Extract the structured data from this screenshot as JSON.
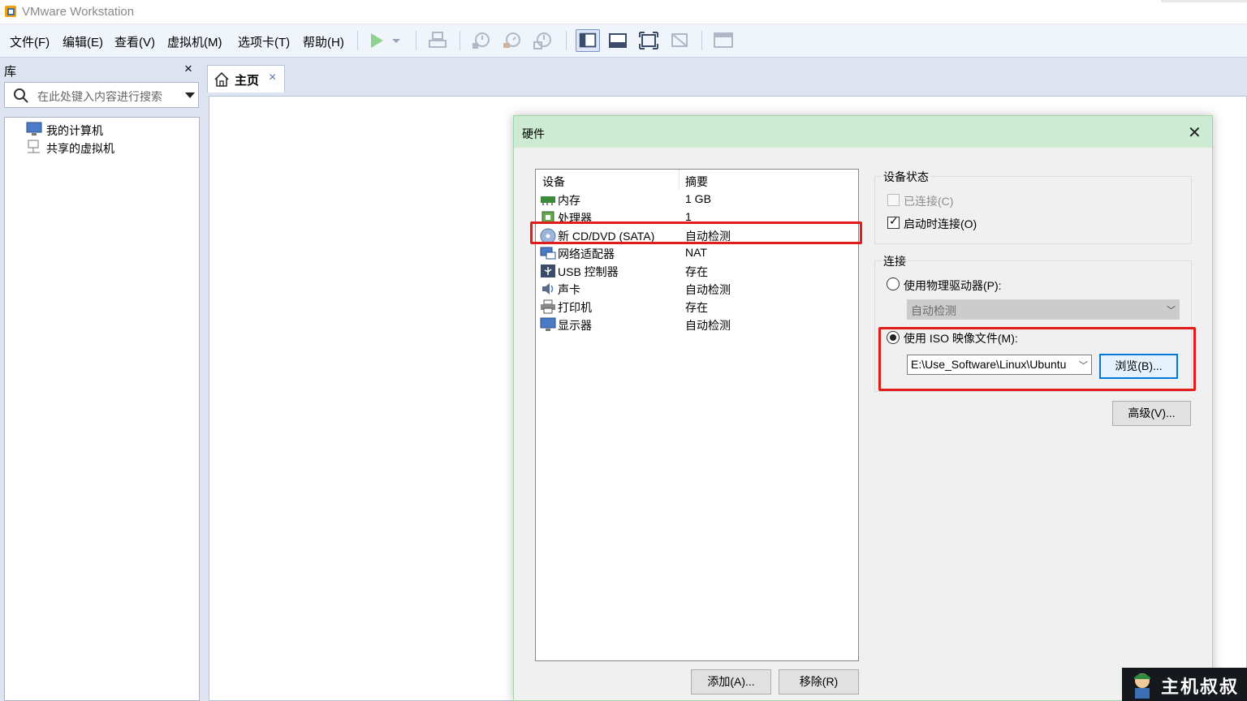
{
  "window": {
    "title": "VMware Workstation"
  },
  "menu": {
    "items": [
      "文件(F)",
      "编辑(E)",
      "查看(V)",
      "虚拟机(M)",
      "选项卡(T)",
      "帮助(H)"
    ]
  },
  "toolbar": {
    "icons": [
      "play-icon",
      "dropdown-icon",
      "send-keys-icon",
      "snapshot-take-icon",
      "snapshot-revert-icon",
      "snapshot-manager-icon",
      "view-library-icon",
      "view-thumbnail-icon",
      "fullscreen-icon",
      "unity-icon",
      "console-view-icon"
    ],
    "accent": "#4caf50"
  },
  "library": {
    "header": "库",
    "close": "×",
    "search_placeholder": "在此处键入内容进行搜索",
    "tree": [
      "我的计算机",
      "共享的虚拟机"
    ]
  },
  "tabs": [
    {
      "label": "主页",
      "close": "×"
    }
  ],
  "dialog": {
    "title": "硬件",
    "close": "✕",
    "columns": {
      "device": "设备",
      "summary": "摘要"
    },
    "devices": [
      {
        "name": "内存",
        "summary": "1 GB",
        "icon": "memory-icon"
      },
      {
        "name": "处理器",
        "summary": "1",
        "icon": "cpu-icon"
      },
      {
        "name": "新 CD/DVD (SATA)",
        "summary": "自动检测",
        "icon": "cd-dvd-icon"
      },
      {
        "name": "网络适配器",
        "summary": "NAT",
        "icon": "network-icon"
      },
      {
        "name": "USB 控制器",
        "summary": "存在",
        "icon": "usb-icon"
      },
      {
        "name": "声卡",
        "summary": "自动检测",
        "icon": "sound-icon"
      },
      {
        "name": "打印机",
        "summary": "存在",
        "icon": "printer-icon"
      },
      {
        "name": "显示器",
        "summary": "自动检测",
        "icon": "display-icon"
      }
    ],
    "add_button": "添加(A)...",
    "remove_button": "移除(R)",
    "device_status": {
      "legend": "设备状态",
      "connected": {
        "label": "已连接(C)",
        "checked": false,
        "enabled": false
      },
      "connect_at_power_on": {
        "label": "启动时连接(O)",
        "checked": true,
        "enabled": true
      }
    },
    "connection": {
      "legend": "连接",
      "physical": {
        "label": "使用物理驱动器(P):",
        "selected": false,
        "value": "自动检测"
      },
      "iso": {
        "label": "使用 ISO 映像文件(M):",
        "selected": true,
        "value": "E:\\Use_Software\\Linux\\Ubuntu",
        "browse": "浏览(B)..."
      }
    },
    "advanced_button": "高级(V)..."
  },
  "highlight_color": "#e21b1b",
  "watermark": {
    "text": "主机叔叔"
  }
}
